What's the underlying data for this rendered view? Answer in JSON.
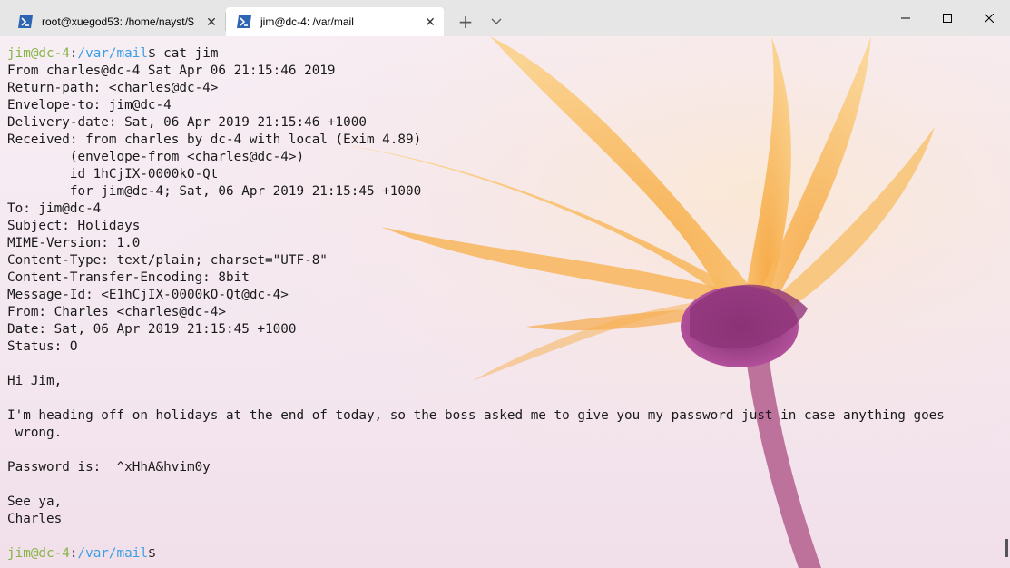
{
  "tabs": [
    {
      "title": "root@xuegod53: /home/nayst/$",
      "icon": "powershell-icon",
      "active": false
    },
    {
      "title": "jim@dc-4: /var/mail",
      "icon": "powershell-icon",
      "active": true
    }
  ],
  "colors": {
    "prompt_user": "#86b446",
    "prompt_path": "#3a9ee6",
    "text": "#1a1a1a"
  },
  "terminal": {
    "prompt1": {
      "user": "jim@dc-4",
      "sep": ":",
      "path": "/var/mail",
      "symbol": "$",
      "command": " cat jim"
    },
    "lines": [
      "From charles@dc-4 Sat Apr 06 21:15:46 2019",
      "Return-path: <charles@dc-4>",
      "Envelope-to: jim@dc-4",
      "Delivery-date: Sat, 06 Apr 2019 21:15:46 +1000",
      "Received: from charles by dc-4 with local (Exim 4.89)",
      "        (envelope-from <charles@dc-4>)",
      "        id 1hCjIX-0000kO-Qt",
      "        for jim@dc-4; Sat, 06 Apr 2019 21:15:45 +1000",
      "To: jim@dc-4",
      "Subject: Holidays",
      "MIME-Version: 1.0",
      "Content-Type: text/plain; charset=\"UTF-8\"",
      "Content-Transfer-Encoding: 8bit",
      "Message-Id: <E1hCjIX-0000kO-Qt@dc-4>",
      "From: Charles <charles@dc-4>",
      "Date: Sat, 06 Apr 2019 21:15:45 +1000",
      "Status: O",
      "",
      "Hi Jim,",
      "",
      "I'm heading off on holidays at the end of today, so the boss asked me to give you my password just in case anything goes",
      " wrong.",
      "",
      "Password is:  ^xHhA&hvim0y",
      "",
      "See ya,",
      "Charles",
      ""
    ],
    "prompt2": {
      "user": "jim@dc-4",
      "sep": ":",
      "path": "/var/mail",
      "symbol": "$"
    }
  }
}
